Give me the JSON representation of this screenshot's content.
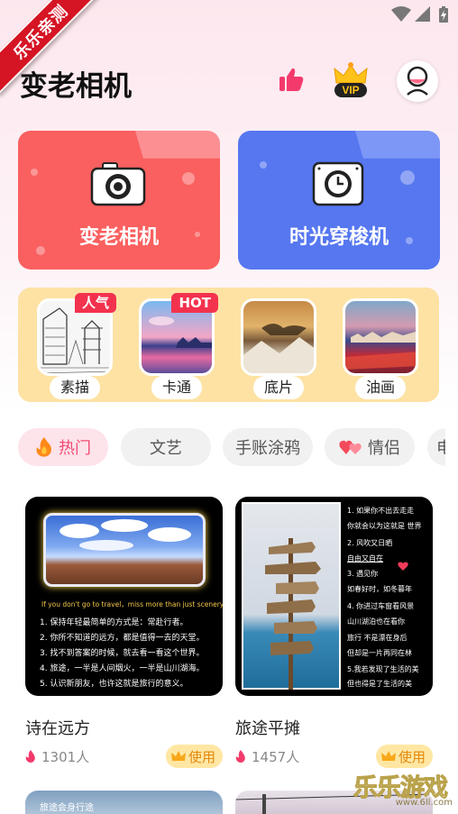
{
  "ribbon": {
    "text": "乐乐亲测"
  },
  "header": {
    "title": "变老相机"
  },
  "feature_cards": [
    {
      "label": "变老相机"
    },
    {
      "label": "时光穿梭机"
    }
  ],
  "styles": [
    {
      "label": "素描",
      "badge": "人气"
    },
    {
      "label": "卡通",
      "badge": "HOT"
    },
    {
      "label": "底片",
      "badge": ""
    },
    {
      "label": "油画",
      "badge": ""
    }
  ],
  "tabs": [
    {
      "label": "热门"
    },
    {
      "label": "文艺"
    },
    {
      "label": "手账涂鸦"
    },
    {
      "label": "情侣"
    },
    {
      "label": "电"
    }
  ],
  "templates": [
    {
      "name": "诗在远方",
      "count": "1301人",
      "use_label": "使用",
      "caption": "If you don't go to travel，miss more than just scenery",
      "lines": [
        "1. 保持年轻最简单的方式是：常赴行者。",
        "2. 你所不知道的远方，都是值得一去的天堂。",
        "3. 找不到答案的时候，就去看一看这个世界。",
        "4. 旅途，一半是人间烟火，一半是山川湖海。",
        "5. 认识新朋友，也许这就是旅行的意义。"
      ]
    },
    {
      "name": "旅途平摊",
      "count": "1457人",
      "use_label": "使用",
      "lines": [
        "1. 如果你不出去走走",
        "你就会以为这就是 世界",
        "2. 风吹又日晒",
        "自由又自在",
        "3. 遇见你",
        "如春好时，如冬暮年",
        "4. 你进过车窗看风景",
        "山川湖泊也在看你",
        "旅行 不是漂在身后",
        "但却是一片再同在林",
        "5.我若发现了生活的美",
        "但也得是了生活的美"
      ]
    }
  ],
  "bottom_cards": [
    {
      "caption": "旅途会身行途"
    }
  ],
  "watermark": {
    "title": "乐乐游戏",
    "url": "www.6ll.com"
  },
  "colors": {
    "accent_pink": "#f04b73",
    "card_red": "#f9605f",
    "card_blue": "#5677f0",
    "panel_yellow": "#fde2a4",
    "badge_red": "#f3324e"
  }
}
